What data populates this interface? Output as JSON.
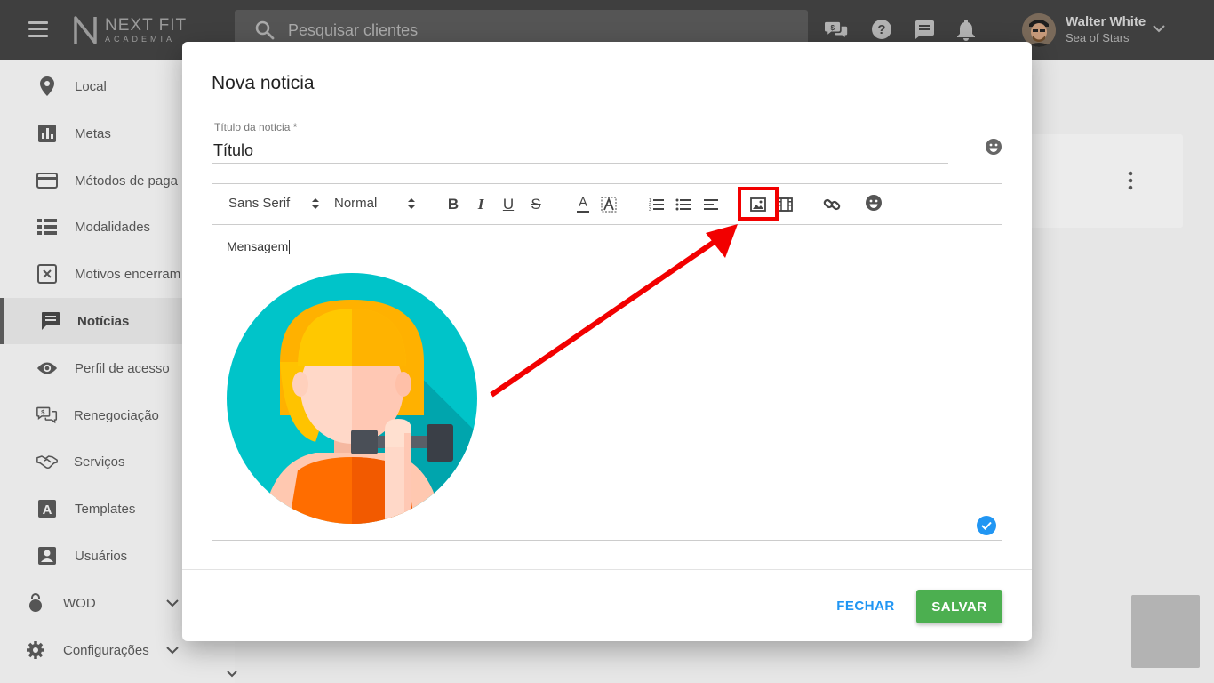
{
  "app": {
    "logo_line1": "NEXT FIT",
    "logo_line2": "ACADEMIA"
  },
  "header": {
    "search_placeholder": "Pesquisar clientes",
    "user_name": "Walter White",
    "user_subtitle": "Sea of Stars"
  },
  "sidebar": {
    "items": [
      {
        "label": "Local",
        "icon": "location-pin-icon"
      },
      {
        "label": "Metas",
        "icon": "bar-chart-icon"
      },
      {
        "label": "Métodos de paga",
        "icon": "credit-card-icon"
      },
      {
        "label": "Modalidades",
        "icon": "list-icon"
      },
      {
        "label": "Motivos encerram",
        "icon": "close-box-icon"
      },
      {
        "label": "Notícias",
        "icon": "message-icon",
        "active": true
      },
      {
        "label": "Perfil de acesso",
        "icon": "eye-icon"
      },
      {
        "label": "Renegociação",
        "icon": "money-chat-icon"
      },
      {
        "label": "Serviços",
        "icon": "handshake-icon"
      },
      {
        "label": "Templates",
        "icon": "letter-a-icon"
      },
      {
        "label": "Usuários",
        "icon": "user-box-icon"
      },
      {
        "label": "WOD",
        "icon": "kettlebell-icon"
      },
      {
        "label": "Configurações",
        "icon": "gear-icon"
      }
    ]
  },
  "dialog": {
    "title": "Nova noticia",
    "title_field_label": "Título da notícia *",
    "title_field_value": "Título",
    "toolbar": {
      "font": "Sans Serif",
      "size": "Normal",
      "bold": "B",
      "italic": "I",
      "underline": "U",
      "strike": "S",
      "text_color": "A"
    },
    "body_text": "Mensagem",
    "close_label": "FECHAR",
    "save_label": "SALVAR"
  },
  "colors": {
    "accent_blue": "#2196f3",
    "save_green": "#4caf50",
    "annotation_red": "#f20000",
    "topbar": "#3f3f3f"
  }
}
